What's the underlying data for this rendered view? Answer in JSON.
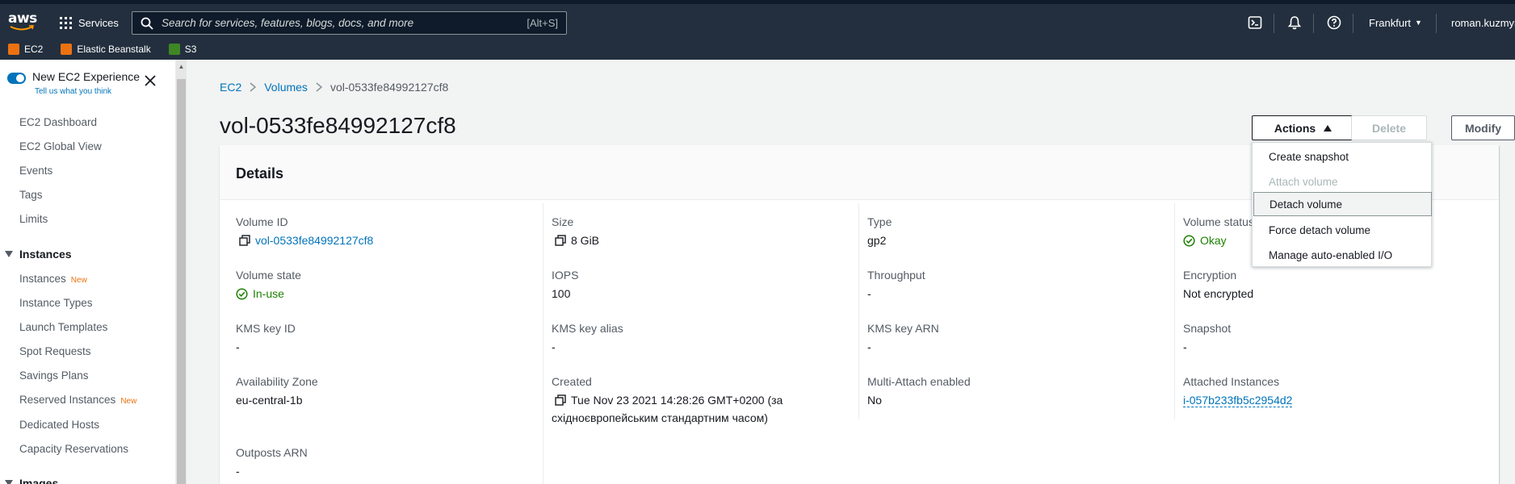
{
  "topnav": {
    "logo_text": "aws",
    "services_label": "Services",
    "search_placeholder": "Search for services, features, blogs, docs, and more",
    "search_shortcut": "[Alt+S]",
    "region": "Frankfurt",
    "user": "roman.kuzmyn"
  },
  "favorites": [
    {
      "label": "EC2",
      "color": "#ec7211",
      "icon": "ec2-icon"
    },
    {
      "label": "Elastic Beanstalk",
      "color": "#ec7211",
      "icon": "beanstalk-icon"
    },
    {
      "label": "S3",
      "color": "#3f8624",
      "icon": "s3-icon"
    }
  ],
  "sidebar": {
    "experience_title": "New EC2 Experience",
    "experience_link": "Tell us what you think",
    "items": [
      {
        "label": "EC2 Dashboard"
      },
      {
        "label": "EC2 Global View"
      },
      {
        "label": "Events"
      },
      {
        "label": "Tags"
      },
      {
        "label": "Limits"
      }
    ],
    "section_instances": "Instances",
    "instances_items": [
      {
        "label": "Instances",
        "badge": "New"
      },
      {
        "label": "Instance Types"
      },
      {
        "label": "Launch Templates"
      },
      {
        "label": "Spot Requests"
      },
      {
        "label": "Savings Plans"
      },
      {
        "label": "Reserved Instances",
        "badge": "New"
      },
      {
        "label": "Dedicated Hosts"
      },
      {
        "label": "Capacity Reservations"
      }
    ],
    "next_section_partial": "Images"
  },
  "breadcrumb": [
    "EC2",
    "Volumes",
    "vol-0533fe84992127cf8"
  ],
  "page_title": "vol-0533fe84992127cf8",
  "buttons": {
    "actions": "Actions",
    "delete": "Delete",
    "modify": "Modify"
  },
  "actions_menu": [
    {
      "label": "Create snapshot",
      "disabled": false
    },
    {
      "label": "Attach volume",
      "disabled": true
    },
    {
      "label": "Detach volume",
      "disabled": false,
      "highlighted": true
    },
    {
      "label": "Force detach volume",
      "disabled": false
    },
    {
      "label": "Manage auto-enabled I/O",
      "disabled": false
    }
  ],
  "details": {
    "title": "Details",
    "volume_id_label": "Volume ID",
    "volume_id": "vol-0533fe84992127cf8",
    "size_label": "Size",
    "size": "8 GiB",
    "type_label": "Type",
    "type": "gp2",
    "volume_status_label": "Volume status",
    "volume_status": "Okay",
    "volume_state_label": "Volume state",
    "volume_state": "In-use",
    "iops_label": "IOPS",
    "iops": "100",
    "throughput_label": "Throughput",
    "throughput": "-",
    "encryption_label": "Encryption",
    "encryption": "Not encrypted",
    "kms_key_id_label": "KMS key ID",
    "kms_key_id": "-",
    "kms_key_alias_label": "KMS key alias",
    "kms_key_alias": "-",
    "kms_key_arn_label": "KMS key ARN",
    "kms_key_arn": "-",
    "snapshot_label": "Snapshot",
    "snapshot": "-",
    "az_label": "Availability Zone",
    "az": "eu-central-1b",
    "created_label": "Created",
    "created_line1": "Tue Nov 23 2021 14:28:26 GMT+0200 (за",
    "created_line2": "східноєвропейським стандартним часом)",
    "multi_attach_label": "Multi-Attach enabled",
    "multi_attach": "No",
    "attached_label": "Attached Instances",
    "attached": "i-057b233fb5c2954d2",
    "outposts_label": "Outposts ARN",
    "outposts": "-"
  }
}
